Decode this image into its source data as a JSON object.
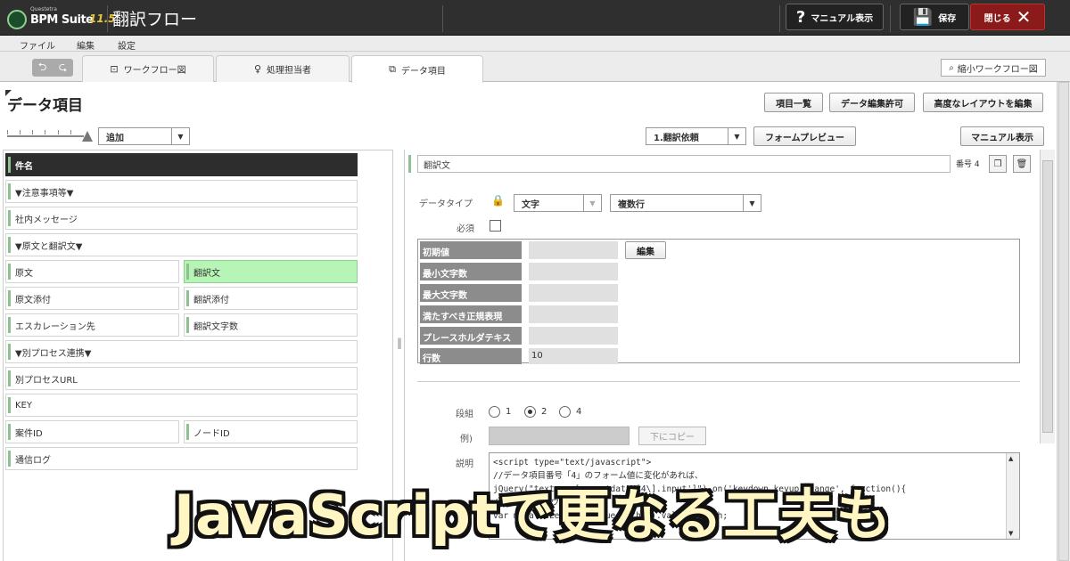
{
  "app": {
    "logo_small": "Questetra",
    "logo_name": "BPM Suite",
    "logo_version": "11.5",
    "title": "翻訳フロー"
  },
  "topbar": {
    "manual_label": "マニュアル表示",
    "save_label": "保存",
    "close_label": "閉じる"
  },
  "menu": [
    "ファイル",
    "編集",
    "設定"
  ],
  "tabs": [
    {
      "label": "ワークフロー図",
      "icon": "flow-icon"
    },
    {
      "label": "処理担当者",
      "icon": "person-icon"
    },
    {
      "label": "データ項目",
      "icon": "data-item-icon"
    }
  ],
  "mini_workflow_label": "縮小ワークフロー図",
  "page_title": "データ項目",
  "header_buttons": {
    "item_list": "項目一覧",
    "data_edit_permission": "データ編集許可",
    "advanced_layout": "高度なレイアウトを編集"
  },
  "add_select": "追加",
  "step_select": "1.翻訳依頼",
  "form_preview": "フォームプレビュー",
  "manual_show": "マニュアル表示",
  "fields": {
    "f0": "件名",
    "f1": "▼注意事項等▼",
    "f2": "社内メッセージ",
    "f3": "▼原文と翻訳文▼",
    "f4a": "原文",
    "f4b": "翻訳文",
    "f5a": "原文添付",
    "f5b": "翻訳添付",
    "f6a": "エスカレーション先",
    "f6b": "翻訳文字数",
    "f7": "▼別プロセス連携▼",
    "f8": "別プロセスURL",
    "f9": "KEY",
    "f10a": "案件ID",
    "f10b": "ノードID",
    "f11": "通信ログ"
  },
  "detail": {
    "name_value": "翻訳文",
    "number_label": "番号 4",
    "datatype_label": "データタイプ",
    "datatype_value": "文字",
    "multiline_value": "複数行",
    "required_label": "必須",
    "required_checked": false,
    "props": [
      {
        "key": "初期値",
        "value": ""
      },
      {
        "key": "最小文字数",
        "value": ""
      },
      {
        "key": "最大文字数",
        "value": ""
      },
      {
        "key": "満たすべき正規表現",
        "value": ""
      },
      {
        "key": "プレースホルダテキスト",
        "value": ""
      },
      {
        "key": "行数",
        "value": "10"
      }
    ],
    "edit_button": "編集",
    "columns_label": "段組",
    "column_options": [
      "1",
      "2",
      "4"
    ],
    "column_selected": "2",
    "example_label": "例)",
    "copy_down_button": "下にコピー",
    "description_label": "説明",
    "description_lines": [
      "<script type=\"text/javascript\">",
      "//データ項目番号「4」のフォーム値に変化があれば、",
      "jQuery(\"textarea[name='data\\[4\\].input']\").on('keydown keyup change', function(){",
      "  // 文字数をカウント",
      "  var myValueLength = jQuery(this).val().length;"
    ]
  },
  "overlay_caption": "JavaScriptで更なる工夫も"
}
